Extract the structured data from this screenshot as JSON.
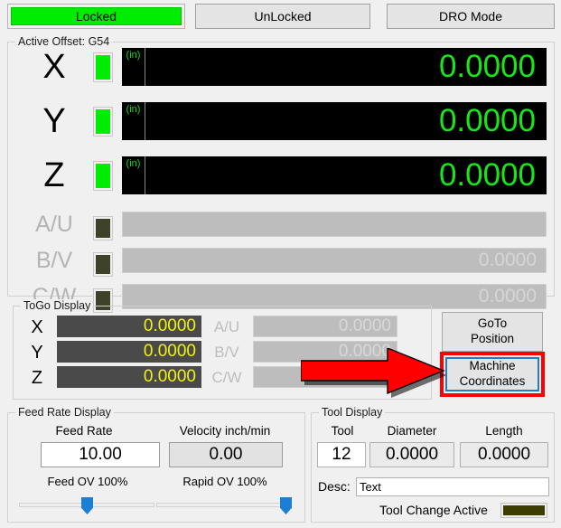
{
  "topbar": {
    "locked_label": "Locked",
    "unlocked_label": "UnLocked",
    "dro_mode_label": "DRO Mode",
    "locked_active_color": "#00ec00"
  },
  "dro_group": {
    "legend": "Active Offset: G54",
    "axes": [
      {
        "label": "X",
        "units": "(in)",
        "value": "0.0000",
        "enabled": true
      },
      {
        "label": "Y",
        "units": "(in)",
        "value": "0.0000",
        "enabled": true
      },
      {
        "label": "Z",
        "units": "(in)",
        "value": "0.0000",
        "enabled": true
      },
      {
        "label": "A/U",
        "units": "",
        "value": "",
        "enabled": false
      },
      {
        "label": "B/V",
        "units": "",
        "value": "0.0000",
        "enabled": false
      },
      {
        "label": "C/W",
        "units": "",
        "value": "0.0000",
        "enabled": false
      }
    ]
  },
  "togo": {
    "legend": "ToGo Display",
    "left_rows": [
      {
        "label": "X",
        "value": "0.0000"
      },
      {
        "label": "Y",
        "value": "0.0000"
      },
      {
        "label": "Z",
        "value": "0.0000"
      }
    ],
    "right_rows": [
      {
        "label": "A/U",
        "value": "0.0000"
      },
      {
        "label": "B/V",
        "value": "0.0000"
      },
      {
        "label": "C/W",
        "value": ""
      }
    ]
  },
  "side_buttons": {
    "goto_line1": "GoTo",
    "goto_line2": "Position",
    "machine_line1": "Machine",
    "machine_line2": "Coordinates",
    "highlight_color": "#ff0000",
    "focus_color": "#1f7fc4"
  },
  "feed": {
    "legend": "Feed Rate Display",
    "feed_rate_label": "Feed Rate",
    "feed_rate_value": "10.00",
    "velocity_label": "Velocity inch/min",
    "velocity_value": "0.00",
    "feed_ov_label": "Feed OV 100%",
    "feed_ov_percent": 100,
    "rapid_ov_label": "Rapid OV 100%",
    "rapid_ov_percent": 100
  },
  "tool": {
    "legend": "Tool Display",
    "tool_label": "Tool",
    "tool_value": "12",
    "diameter_label": "Diameter",
    "diameter_value": "0.0000",
    "length_label": "Length",
    "length_value": "0.0000",
    "desc_label": "Desc:",
    "desc_value": "Text",
    "tool_change_label": "Tool Change Active",
    "tool_change_color": "#3d3d00"
  }
}
